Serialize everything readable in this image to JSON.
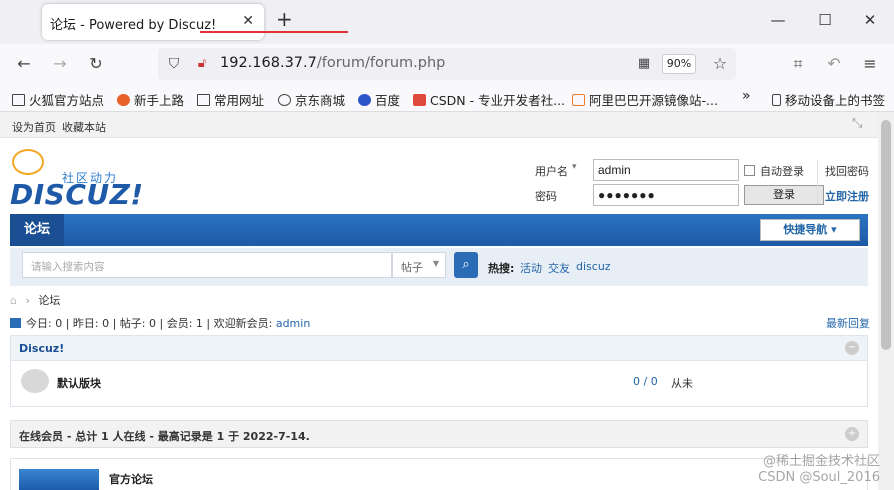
{
  "browser": {
    "tab_title": "论坛 - Powered by Discuz!",
    "url_host": "192.168.37.7",
    "url_path": "/forum/forum.php",
    "zoom": "90%"
  },
  "bookmarks": [
    "火狐官方站点",
    "新手上路",
    "常用网址",
    "京东商城",
    "百度",
    "CSDN - 专业开发者社...",
    "阿里巴巴开源镜像站-...",
    "移动设备上的书签"
  ],
  "topbar": {
    "set_home": "设为首页",
    "favorite": "收藏本站"
  },
  "logo": {
    "brand": "DISCUZ!",
    "slogan": "社区动力"
  },
  "login": {
    "username_label": "用户名",
    "username_value": "admin",
    "password_label": "密码",
    "password_value": "●●●●●●●",
    "remember": "自动登录",
    "login_button": "登录",
    "forgot": "找回密码",
    "register": "立即注册"
  },
  "nav": {
    "active_tab": "论坛",
    "quick_nav": "快捷导航 ▾"
  },
  "search": {
    "placeholder": "请输入搜索内容",
    "type": "帖子",
    "hot_label": "热搜:",
    "hot_items": [
      "活动",
      "交友",
      "discuz"
    ]
  },
  "breadcrumb": {
    "current": "论坛"
  },
  "stats": {
    "today": "今日: 0",
    "yesterday": "昨日: 0",
    "posts": "帖子: 0",
    "members": "会员: 1",
    "welcome": "欢迎新会员: ",
    "new_member": "admin",
    "latest": "最新回复"
  },
  "category": {
    "title": "Discuz!",
    "forum_name": "默认版块",
    "counts": "0 / 0",
    "last": "从未"
  },
  "online": {
    "title": "在线会员 - 总计 1 人在线 - 最高记录是 1 于 2022-7-14.",
    "official_title": "官方论坛"
  },
  "watermark": {
    "line1": "@稀土掘金技术社区",
    "line2": "CSDN @Soul_2016"
  }
}
